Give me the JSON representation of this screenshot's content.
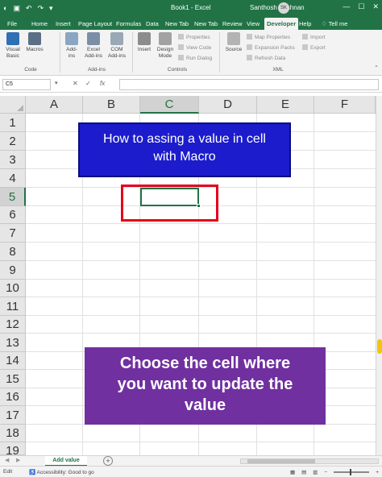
{
  "titlebar": {
    "file_name": "Book1  -  Excel",
    "user": "Santhosh Krishnan",
    "avatar": "SK",
    "icons": [
      "autosave-icon",
      "save-icon",
      "undo-icon",
      "redo-icon",
      "customize-icon"
    ],
    "min": "—",
    "max": "☐",
    "close": "✕"
  },
  "tabs": [
    "File",
    "Home",
    "Insert",
    "Page Layout",
    "Formulas",
    "Data",
    "New Tab",
    "New Tab",
    "Review",
    "View",
    "Developer",
    "Help",
    "Tell me"
  ],
  "ribbon": {
    "code": {
      "visual_basic": "Visual Basic",
      "macros": "Macros",
      "label": "Code"
    },
    "addins": {
      "addins": "Add-ins",
      "excel_addins": "Excel Add-ins",
      "com_addins": "COM Add-ins",
      "label": "Add-ins"
    },
    "controls": {
      "insert": "Insert",
      "design_mode": "Design Mode",
      "properties": "Properties",
      "view_code": "View Code",
      "run_dialog": "Run Dialog",
      "label": "Controls"
    },
    "xml": {
      "source": "Source",
      "map_properties": "Map Properties",
      "expansion_packs": "Expansion Packs",
      "refresh_data": "Refresh Data",
      "import": "Import",
      "export": "Export",
      "label": "XML"
    }
  },
  "formula_bar": {
    "name_box": "C5",
    "cancel": "✕",
    "enter": "✓",
    "fx": "fx",
    "value": ""
  },
  "grid": {
    "columns": [
      "A",
      "B",
      "C",
      "D",
      "E",
      "F"
    ],
    "rows": [
      "1",
      "2",
      "3",
      "4",
      "5",
      "6",
      "7",
      "8",
      "9",
      "10",
      "11",
      "12",
      "13",
      "14",
      "15",
      "16",
      "17",
      "18",
      "19"
    ],
    "active_cell": "C5"
  },
  "overlay": {
    "title_line1": "How to assing a value in cell",
    "title_line2": "with Macro",
    "hint_line1": "Choose the cell where",
    "hint_line2": "you want to update the",
    "hint_line3": "value"
  },
  "sheets": {
    "active": "Add value",
    "add": "+"
  },
  "status": {
    "mode": "Edit",
    "accessibility": "Accessibility: Good to go"
  },
  "colors": {
    "excel_green": "#217346",
    "banner_blue": "#1c1ccc",
    "banner_purple": "#7030a0",
    "highlight_red": "#e3001b"
  }
}
